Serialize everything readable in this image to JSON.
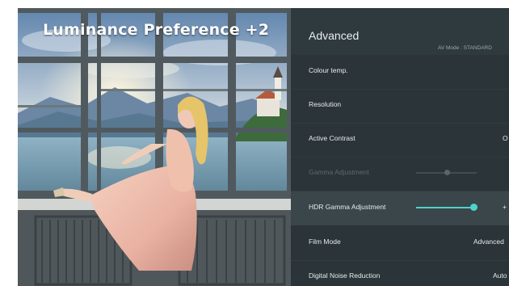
{
  "photo": {
    "caption": "Luminance Preference +2"
  },
  "menu": {
    "title": "Advanced",
    "subtitle": "AV Mode : STANDARD",
    "items": [
      {
        "label": "Colour temp.",
        "value": ""
      },
      {
        "label": "Resolution",
        "value": ""
      },
      {
        "label": "Active Contrast",
        "value": "O"
      },
      {
        "label": "Gamma Adjustment",
        "value": "",
        "disabled": true,
        "slider_level": 0.5
      },
      {
        "label": "HDR Gamma Adjustment",
        "value": "+",
        "selected": true,
        "slider_level": 0.95
      },
      {
        "label": "Film Mode",
        "value": "Advanced"
      },
      {
        "label": "Digital Noise Reduction",
        "value": "Auto"
      }
    ]
  },
  "colors": {
    "accent": "#4ed3c9",
    "menu_background": "#2b3438",
    "selected_row": "#3a4649"
  }
}
